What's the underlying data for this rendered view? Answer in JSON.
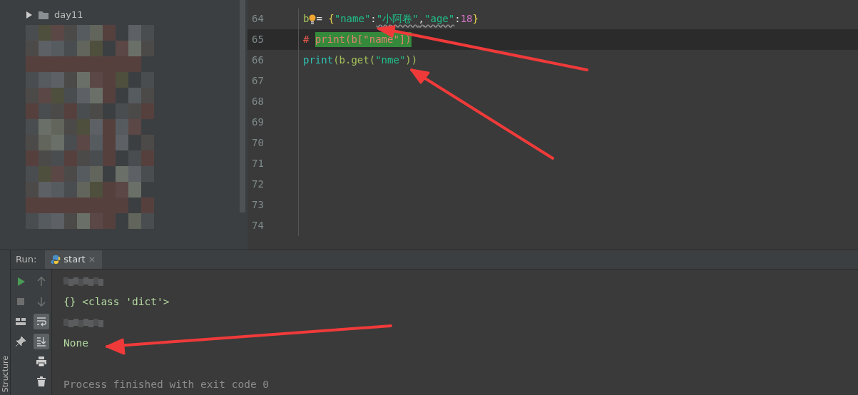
{
  "project_tree": {
    "items": [
      {
        "label": "day11",
        "expanded": false
      }
    ]
  },
  "editor": {
    "lines": [
      {
        "number": "64",
        "current": false,
        "intention": true,
        "tokens": [
          {
            "text": "b",
            "kind": "ident"
          },
          {
            "text": "= ",
            "kind": "op"
          },
          {
            "text": "{",
            "kind": "brace"
          },
          {
            "text": "\"name\"",
            "kind": "string"
          },
          {
            "text": ":",
            "kind": "op"
          },
          {
            "text": "\"小阿卷\"",
            "kind": "string",
            "warning": true
          },
          {
            "text": ",",
            "kind": "op",
            "warning": true
          },
          {
            "text": "\"age\"",
            "kind": "string",
            "warning": true
          },
          {
            "text": ":",
            "kind": "op"
          },
          {
            "text": "18",
            "kind": "number"
          },
          {
            "text": "}",
            "kind": "brace"
          }
        ]
      },
      {
        "number": "65",
        "current": true,
        "intention": false,
        "tokens": [
          {
            "text": "# ",
            "kind": "comment"
          },
          {
            "text": "print(b[\"name\"])",
            "kind": "comment",
            "selected": true
          }
        ]
      },
      {
        "number": "66",
        "current": false,
        "intention": false,
        "tokens": [
          {
            "text": "print",
            "kind": "builtin"
          },
          {
            "text": "(b.get(",
            "kind": "ident"
          },
          {
            "text": "\"nme\"",
            "kind": "string"
          },
          {
            "text": "))",
            "kind": "ident"
          }
        ]
      },
      {
        "number": "67",
        "current": false,
        "intention": false
      },
      {
        "number": "68",
        "current": false,
        "intention": false
      },
      {
        "number": "69",
        "current": false,
        "intention": false
      },
      {
        "number": "70",
        "current": false,
        "intention": false
      },
      {
        "number": "71",
        "current": false,
        "intention": false
      },
      {
        "number": "72",
        "current": false,
        "intention": false
      },
      {
        "number": "73",
        "current": false,
        "intention": false
      },
      {
        "number": "74",
        "current": false,
        "intention": false
      }
    ]
  },
  "run_panel": {
    "label": "Run:",
    "tabs": [
      {
        "label": "start",
        "selected": true,
        "close": "×"
      }
    ],
    "toolbars": [
      [
        {
          "kind": "rerun",
          "selected": false
        },
        {
          "kind": "stop",
          "selected": false
        },
        {
          "kind": "layout",
          "selected": false
        },
        {
          "kind": "pin",
          "selected": false
        }
      ],
      [
        {
          "kind": "up",
          "selected": false
        },
        {
          "kind": "down",
          "selected": false
        },
        {
          "kind": "wrap",
          "selected": true
        },
        {
          "kind": "scroll-end",
          "selected": true
        },
        {
          "kind": "print",
          "selected": false
        },
        {
          "kind": "trash",
          "selected": false
        }
      ]
    ],
    "output": [
      {
        "kind": "blurred"
      },
      {
        "kind": "text",
        "text": "{} <class 'dict'>"
      },
      {
        "kind": "blurred"
      },
      {
        "kind": "text",
        "text": "None"
      },
      {
        "kind": "blank"
      },
      {
        "kind": "exit",
        "text": "Process finished with exit code 0"
      }
    ]
  },
  "side_strip": {
    "label": "Structure"
  },
  "annotations": [
    {
      "kind": "arrow"
    },
    {
      "kind": "arrow"
    },
    {
      "kind": "arrow"
    }
  ]
}
